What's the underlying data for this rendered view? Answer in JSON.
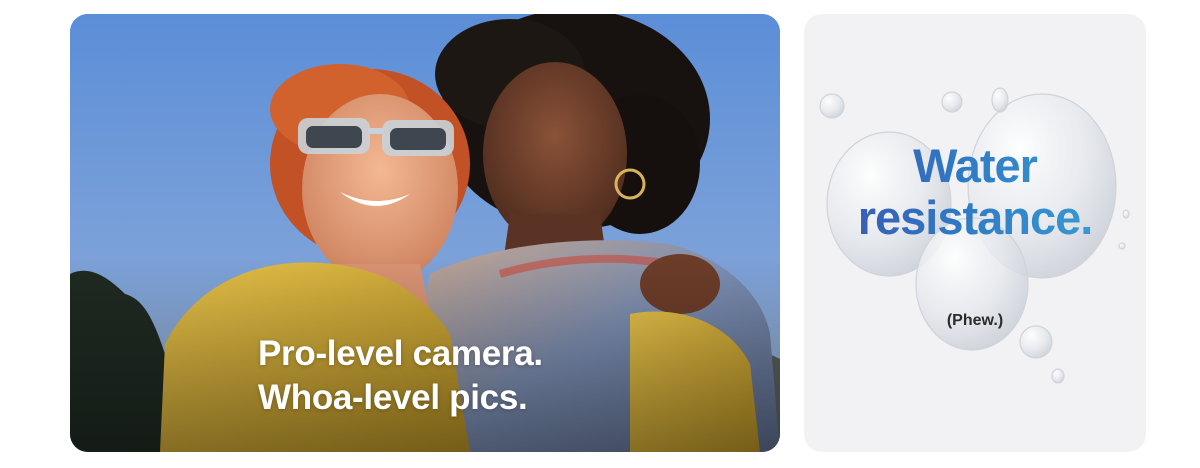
{
  "cards": {
    "camera": {
      "headline_line1": "Pro-level camera.",
      "headline_line2": "Whoa-level pics.",
      "image_alt": "",
      "colors": {
        "sky": "#6f9ad8",
        "sweater": "#d8b43a",
        "hair_red": "#c7542a",
        "hair_dark": "#1a1512",
        "skin_light": "#e9a27d",
        "skin_dark": "#6b3e2b",
        "text": "#ffffff"
      }
    },
    "water": {
      "title_line1": "Water",
      "title_line2": "resistance.",
      "subtitle": "(Phew.)",
      "colors": {
        "background": "#f2f2f4",
        "title_start": "#3e4fae",
        "title_end": "#3aa6d8",
        "subtitle": "#2b2b2b"
      }
    }
  }
}
